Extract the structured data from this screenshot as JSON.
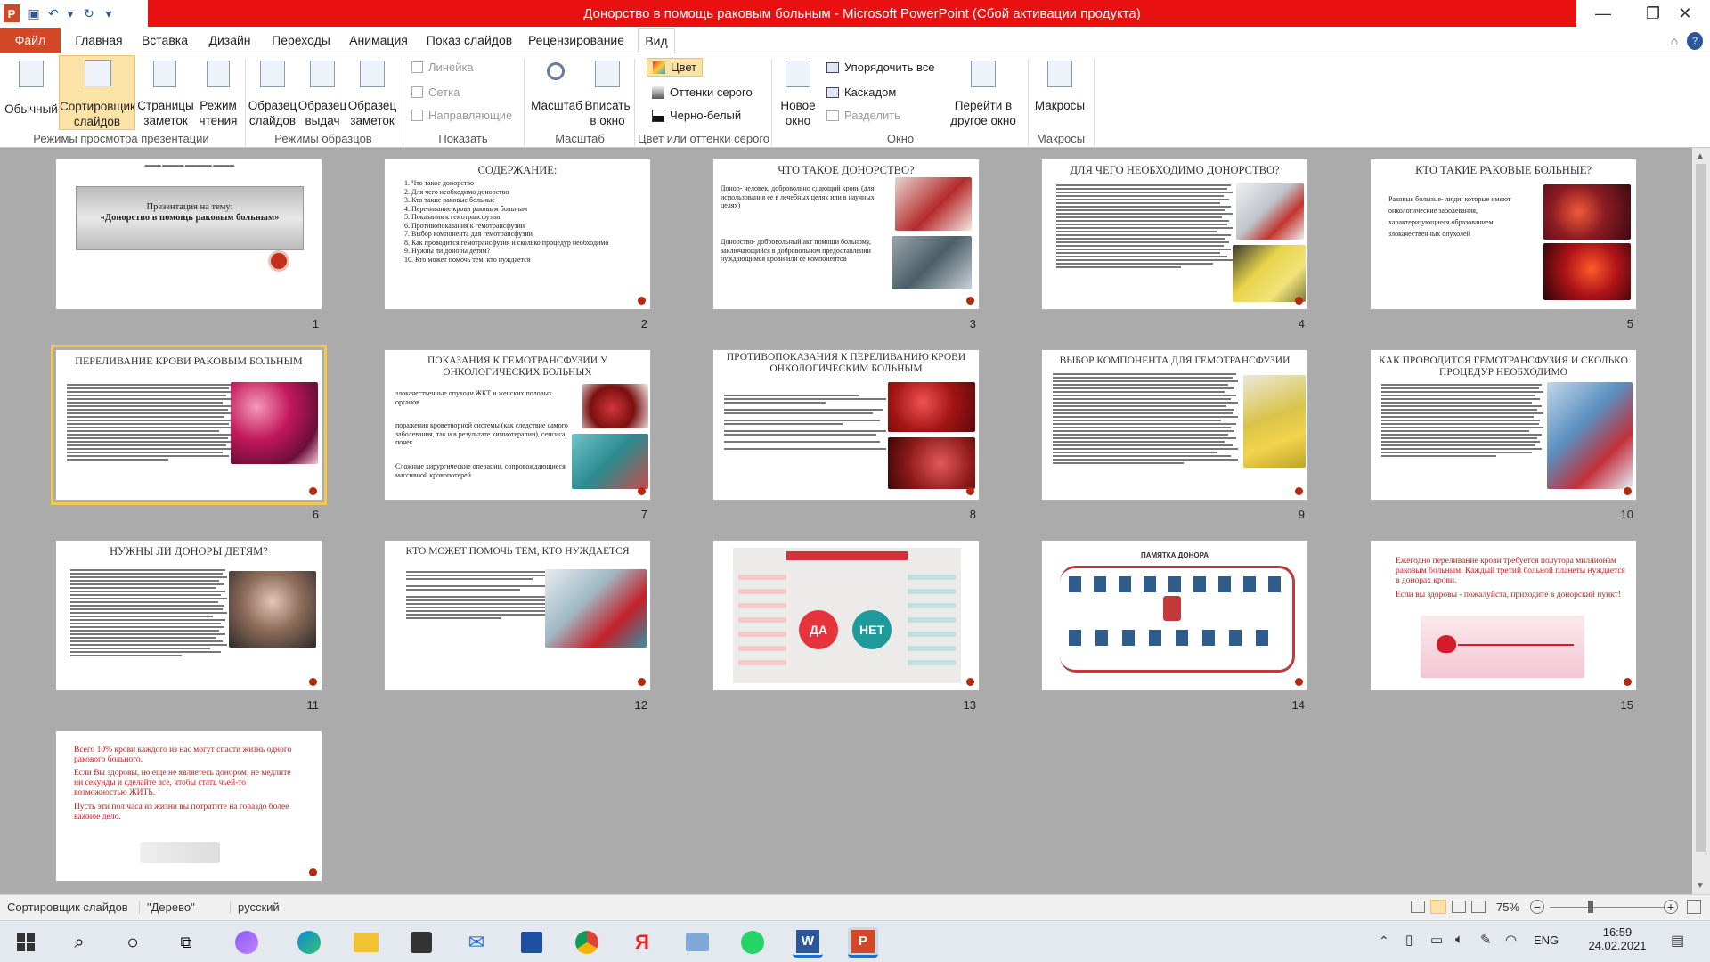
{
  "window": {
    "title": "Донорство в помощь раковым больным  -  Microsoft PowerPoint (Сбой активации продукта)"
  },
  "tabs": [
    "Файл",
    "Главная",
    "Вставка",
    "Дизайн",
    "Переходы",
    "Анимация",
    "Показ слайдов",
    "Рецензирование",
    "Вид"
  ],
  "ribbon": {
    "view_modes": [
      "Обычный",
      "Сортировщик слайдов",
      "Страницы заметок",
      "Режим чтения"
    ],
    "group_view_modes": "Режимы просмотра презентации",
    "master_views": [
      "Образец слайдов",
      "Образец выдач",
      "Образец заметок"
    ],
    "group_masters": "Режимы образцов",
    "show": [
      "Линейка",
      "Сетка",
      "Направляющие"
    ],
    "group_show": "Показать",
    "zoom": [
      "Масштаб",
      "Вписать в окно"
    ],
    "group_zoom": "Масштаб",
    "color": [
      "Цвет",
      "Оттенки серого",
      "Черно-белый"
    ],
    "group_color": "Цвет или оттенки серого",
    "window": [
      "Новое окно",
      "Упорядочить все",
      "Каскадом",
      "Разделить",
      "Перейти в другое окно"
    ],
    "group_window": "Окно",
    "macros": "Макросы",
    "group_macros": "Макросы"
  },
  "slides": [
    {
      "num": "1",
      "heading": "",
      "lines": [
        "Презентация на тему:",
        "«Донорство в помощь раковым больным»"
      ]
    },
    {
      "num": "2",
      "heading": "СОДЕРЖАНИЕ:",
      "lines": [
        "1. Что такое донорство",
        "2. Для чего необходимо донорство",
        "3. Кто такие раковые больные",
        "4. Переливание крови раковым больным",
        "5. Показания к гемотрансфузии",
        "6. Противопоказания к гемотрансфузии",
        "7. Выбор компонента для гемотрансфузии",
        "8. Как проводится гемотрансфузия и сколько процедур необходимо",
        "9. Нужны ли доноры детям?",
        "10. Кто может помочь тем, кто нуждается"
      ]
    },
    {
      "num": "3",
      "heading": "ЧТО ТАКОЕ ДОНОРСТВО?",
      "lines": [
        "Донор- человек, добровольно сдающий кровь (для использования ее в лечебных целях или в научных целях)",
        "Донорство- добровольный акт помощи больному, заключающийся в добровольном предоставлении нуждающимся крови или ее компонентов"
      ]
    },
    {
      "num": "4",
      "heading": "ДЛЯ ЧЕГО НЕОБХОДИМО ДОНОРСТВО?",
      "lines": []
    },
    {
      "num": "5",
      "heading": "КТО ТАКИЕ РАКОВЫЕ БОЛЬНЫЕ?",
      "lines": [
        "Раковые больные- люди, которые имеют онкологические заболевания, характеризующиеся образованием злокачественных опухолей"
      ]
    },
    {
      "num": "6",
      "heading": "ПЕРЕЛИВАНИЕ КРОВИ РАКОВЫМ БОЛЬНЫМ",
      "lines": []
    },
    {
      "num": "7",
      "heading": "ПОКАЗАНИЯ К ГЕМОТРАНСФУЗИИ У ОНКОЛОГИЧЕСКИХ БОЛЬНЫХ",
      "lines": [
        "злокачественные опухоли ЖКТ и женских половых органов",
        "поражения кроветворной системы (как следствие самого заболевания, так и в результате химиотерапии), сепсиса, почек",
        "Сложные хирургические операции, сопровождающиеся массивной кровопотерей"
      ]
    },
    {
      "num": "8",
      "heading": "ПРОТИВОПОКАЗАНИЯ К ПЕРЕЛИВАНИЮ КРОВИ ОНКОЛОГИЧЕСКИМ БОЛЬНЫМ",
      "lines": []
    },
    {
      "num": "9",
      "heading": "ВЫБОР КОМПОНЕНТА ДЛЯ ГЕМОТРАНСФУЗИИ",
      "lines": []
    },
    {
      "num": "10",
      "heading": "КАК ПРОВОДИТСЯ ГЕМОТРАНСФУЗИЯ И СКОЛЬКО ПРОЦЕДУР НЕОБХОДИМО",
      "lines": []
    },
    {
      "num": "11",
      "heading": "НУЖНЫ ЛИ ДОНОРЫ ДЕТЯМ?",
      "lines": []
    },
    {
      "num": "12",
      "heading": "КТО МОЖЕТ ПОМОЧЬ ТЕМ, КТО НУЖДАЕТСЯ",
      "lines": []
    },
    {
      "num": "13",
      "heading": "",
      "lines": [
        "ДА",
        "НЕТ"
      ]
    },
    {
      "num": "14",
      "heading": "ПАМЯТКА ДОНОРА",
      "lines": []
    },
    {
      "num": "15",
      "heading": "",
      "lines": [
        "Ежегодно переливание крови требуется полутора миллионам раковым больным. Каждый третий больной планеты нуждается в донорах крови.",
        "Если вы здоровы - пожалуйста, приходите в донорский пункт!"
      ]
    },
    {
      "num": "16",
      "heading": "",
      "lines": [
        "Всего 10% крови каждого из нас могут спасти жизнь одного ракового больного.",
        "Если Вы здоровы, но еще не являетесь донором, не медлите ни секунды и сделайте все, чтобы стать чьей-то возможностью ЖИТЬ.",
        "Пусть эти пол часа из жизни вы потратите на гораздо более важное дело."
      ]
    }
  ],
  "status": {
    "mode": "Сортировщик слайдов",
    "theme": "\"Дерево\"",
    "language": "русский",
    "zoom": "75%"
  },
  "taskbar": {
    "lang": "ENG",
    "time": "16:59",
    "date": "24.02.2021"
  }
}
